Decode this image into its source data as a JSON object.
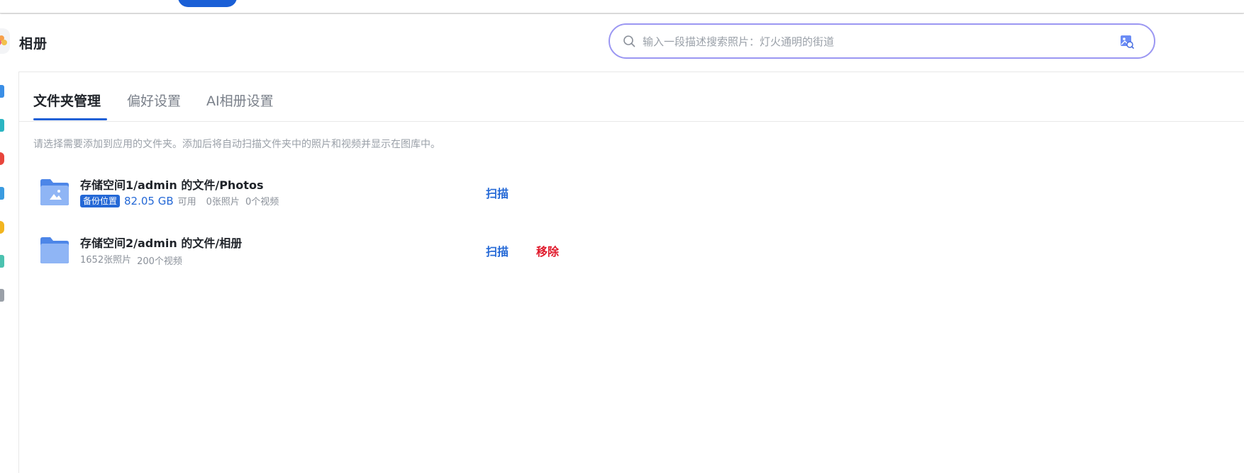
{
  "app": {
    "title": "相册"
  },
  "search": {
    "placeholder": "输入一段描述搜索照片：灯火通明的街道",
    "value": ""
  },
  "tabs": [
    {
      "label": "文件夹管理",
      "active": true
    },
    {
      "label": "偏好设置",
      "active": false
    },
    {
      "label": "AI相册设置",
      "active": false
    }
  ],
  "description": "请选择需要添加到应用的文件夹。添加后将自动扫描文件夹中的照片和视频并显示在图库中。",
  "folders": [
    {
      "name": "存储空间1/admin 的文件/Photos",
      "badge": "备份位置",
      "size": "82.05 GB",
      "size_suffix": "可用",
      "photos": "0张照片",
      "videos": "0个视频",
      "actions": {
        "scan": "扫描"
      }
    },
    {
      "name": "存储空间2/admin 的文件/相册",
      "photos": "1652张照片",
      "videos": "200个视频",
      "actions": {
        "scan": "扫描",
        "remove": "移除"
      }
    }
  ],
  "colors": {
    "accent": "#2468d6",
    "danger": "#e0192b",
    "search_border": "#9b97f2"
  },
  "icons": {
    "sidebar": [
      "photos-icon",
      "albums-icon",
      "favorites-icon",
      "devices-icon",
      "people-icon",
      "places-icon",
      "trash-icon"
    ]
  }
}
